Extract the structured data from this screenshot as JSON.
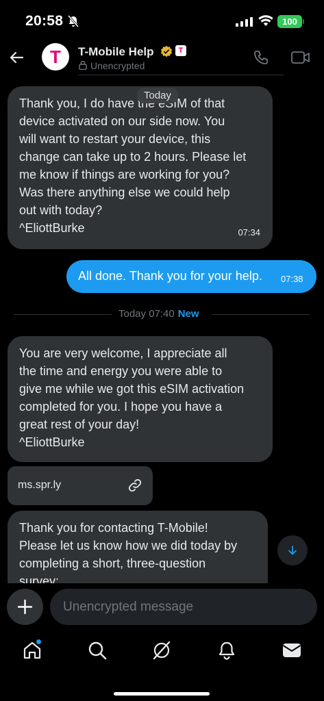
{
  "status_bar": {
    "time": "20:58",
    "battery": "100",
    "icons": [
      "bell-slash-icon",
      "signal-icon",
      "wifi-icon",
      "battery-icon"
    ]
  },
  "header": {
    "name": "T-Mobile Help",
    "avatar_letter": "T",
    "brand_badge_letter": "T",
    "encryption": "Unencrypted",
    "icons": [
      "back-arrow-icon",
      "verified-badge-icon",
      "lock-icon",
      "phone-icon",
      "video-icon"
    ]
  },
  "conversation": {
    "today_pill": "Today",
    "messages": [
      {
        "direction": "in",
        "text": "Thank you, I do have the eSIM of that\ndevice activated on our side now. You\nwill want to restart your device, this\nchange can take up to 2 hours. Please let\nme know if things are working for you?\nWas there anything else we could help\nout with today?\n^EliottBurke",
        "time": "07:34"
      },
      {
        "direction": "out",
        "text": "All done. Thank you for your help.",
        "time": "07:38"
      },
      {
        "direction": "in",
        "text": "You are very welcome, I appreciate all\nthe time and energy you were able to\ngive me while we got this eSIM activation\ncompleted for you. I hope you have a\ngreat rest of your day!\n^EliottBurke"
      },
      {
        "direction": "in",
        "text": "Thank you for contacting T-Mobile!\nPlease let us know how we did today by\ncompleting a short, three-question\nsurvey:"
      }
    ],
    "divider": {
      "label": "Today 07:40",
      "badge": "New"
    },
    "link_card": {
      "url": "ms.spr.ly",
      "icon": "link-icon"
    },
    "scroll_button_icon": "arrow-down-icon"
  },
  "composer": {
    "add_icon": "plus-icon",
    "placeholder": "Unencrypted message"
  },
  "bottom_nav": {
    "items": [
      "home-icon",
      "search-icon",
      "grok-icon",
      "notifications-icon",
      "messages-icon"
    ],
    "home_has_dot": true
  },
  "colors": {
    "accent": "#1d9bf0",
    "bubble_incoming": "#2f3336",
    "brand_magenta": "#e20074",
    "battery_green": "#34c759"
  }
}
